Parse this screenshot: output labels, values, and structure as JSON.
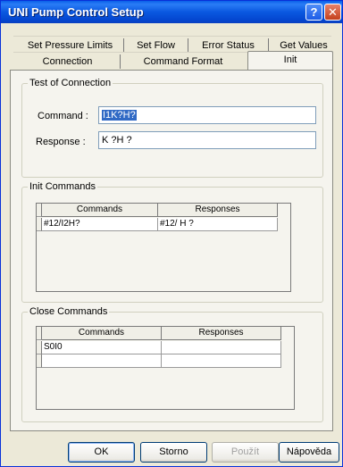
{
  "window": {
    "title": "UNI Pump Control Setup",
    "help_glyph": "?",
    "close_glyph": "✕"
  },
  "tabs": {
    "row_back": [
      "Set Pressure Limits",
      "Set Flow",
      "Error Status",
      "Get Values"
    ],
    "row_front": [
      "Connection",
      "Command Format",
      "Init"
    ],
    "active": "Init"
  },
  "test_connection": {
    "legend": "Test of Connection",
    "command_label": "Command :",
    "command_value": "I1K?H?",
    "response_label": "Response :",
    "response_value": "K ?H ?"
  },
  "init_commands": {
    "legend": "Init Commands",
    "headers": [
      "Commands",
      "Responses"
    ],
    "rows": [
      [
        "#12/I2H?",
        "#12/ H ?"
      ]
    ]
  },
  "close_commands": {
    "legend": "Close Commands",
    "headers": [
      "Commands",
      "Responses"
    ],
    "rows": [
      [
        "S0I0",
        ""
      ],
      [
        "",
        ""
      ]
    ]
  },
  "buttons": {
    "ok": "OK",
    "cancel": "Storno",
    "apply": "Použít",
    "help": "Nápověda"
  },
  "colors": {
    "titlebar": "#0a58e0",
    "face": "#ece9d8",
    "selection": "#316ac5"
  }
}
